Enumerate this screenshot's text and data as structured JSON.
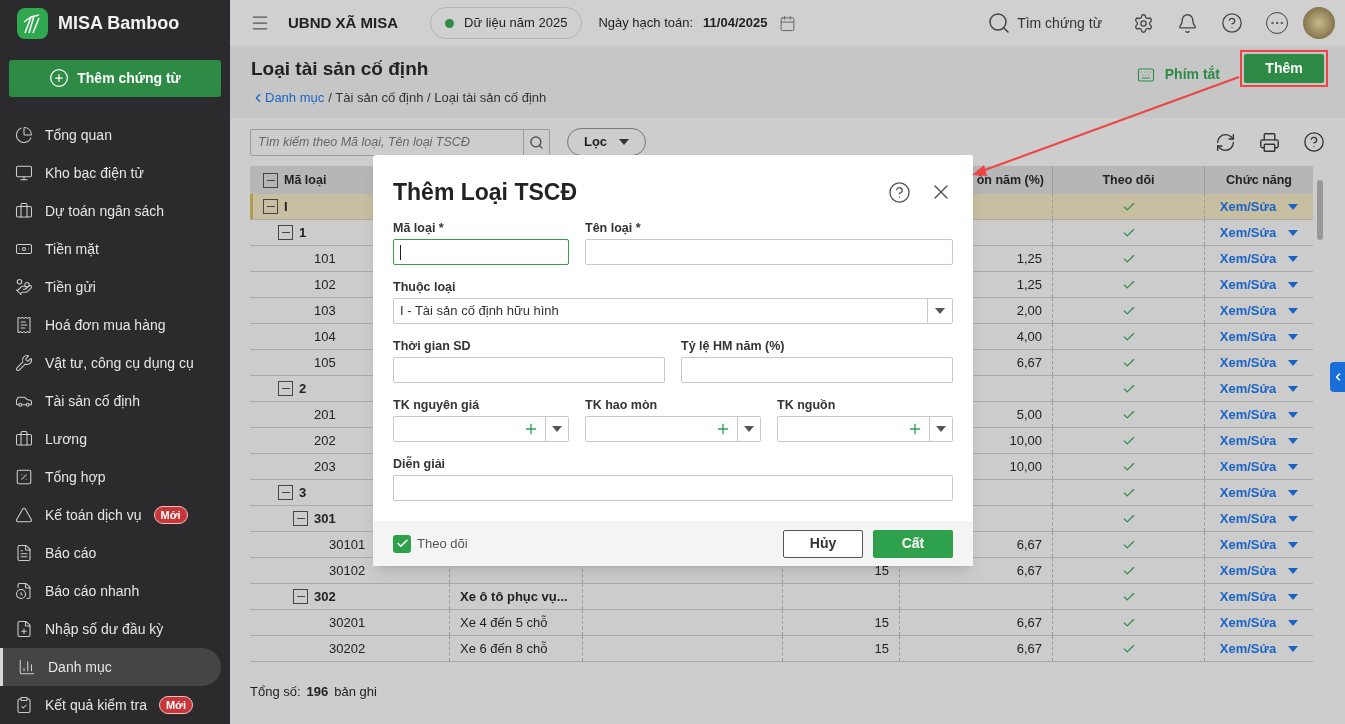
{
  "sidebar": {
    "brand": "MISA Bamboo",
    "new_button": "Thêm chứng từ",
    "items": [
      {
        "label": "Tổng quan",
        "selected": false
      },
      {
        "label": "Kho bạc điện tử",
        "selected": false
      },
      {
        "label": "Dự toán ngân sách",
        "selected": false
      },
      {
        "label": "Tiền mặt",
        "selected": false
      },
      {
        "label": "Tiền gửi",
        "selected": false
      },
      {
        "label": "Hoá đơn mua hàng",
        "selected": false
      },
      {
        "label": "Vật tư, công cụ dụng cụ",
        "selected": false
      },
      {
        "label": "Tài sản cố định",
        "selected": false
      },
      {
        "label": "Lương",
        "selected": false
      },
      {
        "label": "Tổng hợp",
        "selected": false
      },
      {
        "label": "Kế toán dịch vụ",
        "selected": false,
        "badge": "Mới"
      },
      {
        "label": "Báo cáo",
        "selected": false
      },
      {
        "label": "Báo cáo nhanh",
        "selected": false
      },
      {
        "label": "Nhập số dư đầu kỳ",
        "selected": false
      },
      {
        "label": "Danh mục",
        "selected": true
      },
      {
        "label": "Kết quả kiểm tra",
        "selected": false,
        "badge": "Mới"
      }
    ]
  },
  "topbar": {
    "organization": "UBND XÃ MISA",
    "data_year": "Dữ liệu năm 2025",
    "date_label": "Ngày hạch toán:",
    "date": "11/04/2025",
    "search": "Tìm chứng từ"
  },
  "page": {
    "title": "Loại tài sản cố định",
    "breadcrumb_link": "Danh mục",
    "breadcrumb_rest": "/ Tài sản cố định / Loại tài sản cố định",
    "shortcuts": "Phím tắt",
    "add_button": "Thêm"
  },
  "toolbar": {
    "search": {
      "placeholder": "Tìm kiếm theo Mã loại, Tên loại TSCĐ"
    },
    "filter": "Lọc"
  },
  "table": {
    "columns": {
      "code": "Mã loại",
      "column_5": "òn năm (%)",
      "tracked": "Theo dõi",
      "actions": "Chức năng"
    },
    "rows": [
      {
        "code": "I",
        "expanded": true,
        "selected": true,
        "tracked": true,
        "action": "Xem/Sửa",
        "children": [
          {
            "code": "1",
            "expanded": true,
            "selected": false,
            "tracked": true,
            "action": "Xem/Sửa",
            "children": [
              {
                "code": "101",
                "rate": "1,25",
                "selected": false,
                "tracked": true,
                "action": "Xem/Sửa"
              },
              {
                "code": "102",
                "rate": "1,25",
                "selected": false,
                "tracked": true,
                "action": "Xem/Sửa"
              },
              {
                "code": "103",
                "rate": "2,00",
                "selected": false,
                "tracked": true,
                "action": "Xem/Sửa"
              },
              {
                "code": "104",
                "rate": "4,00",
                "selected": false,
                "tracked": true,
                "action": "Xem/Sửa"
              },
              {
                "code": "105",
                "rate": "6,67",
                "selected": false,
                "tracked": true,
                "action": "Xem/Sửa"
              }
            ]
          },
          {
            "code": "2",
            "expanded": true,
            "selected": false,
            "tracked": true,
            "action": "Xem/Sửa",
            "children": [
              {
                "code": "201",
                "rate": "5,00",
                "selected": false,
                "tracked": true,
                "action": "Xem/Sửa"
              },
              {
                "code": "202",
                "rate": "10,00",
                "selected": false,
                "tracked": true,
                "action": "Xem/Sửa"
              },
              {
                "code": "203",
                "rate": "10,00",
                "selected": false,
                "tracked": true,
                "action": "Xem/Sửa"
              }
            ]
          },
          {
            "code": "3",
            "expanded": true,
            "selected": false,
            "tracked": true,
            "action": "Xem/Sửa",
            "children": [
              {
                "code": "301",
                "expanded": true,
                "selected": false,
                "tracked": true,
                "action": "Xem/Sửa",
                "children": [
                  {
                    "code": "30101",
                    "rate": "6,67",
                    "selected": false,
                    "tracked": true,
                    "action": "Xem/Sửa"
                  },
                  {
                    "code": "30102",
                    "column_4": "15",
                    "rate": "6,67",
                    "selected": false,
                    "tracked": true,
                    "action": "Xem/Sửa"
                  }
                ]
              },
              {
                "code": "302",
                "name": "Xe ô tô phục vụ...",
                "expanded": true,
                "selected": false,
                "tracked": true,
                "action": "Xem/Sửa",
                "children": [
                  {
                    "code": "30201",
                    "name": "Xe 4 đến 5 chỗ",
                    "column_4": "15",
                    "rate": "6,67",
                    "selected": false,
                    "tracked": true,
                    "action": "Xem/Sửa"
                  },
                  {
                    "code": "30202",
                    "name": "Xe 6 đến 8 chỗ",
                    "column_4": "15",
                    "rate": "6,67",
                    "selected": false,
                    "tracked": true,
                    "action": "Xem/Sửa"
                  }
                ]
              }
            ]
          }
        ]
      }
    ],
    "total_label": "Tổng số:",
    "total": "196",
    "total_suffix": "bản ghi"
  },
  "dialog": {
    "title": "Thêm Loại TSCĐ",
    "rows": [
      {
        "fields": [
          {
            "label": "Mã loại *",
            "kind": "text",
            "focused": true
          },
          {
            "label": "Tên loại *",
            "kind": "text",
            "focused": false
          }
        ]
      },
      {
        "fields": [
          {
            "label": "Thuộc loại",
            "kind": "select",
            "value": "I - Tài sản cố định hữu hình",
            "focused": false
          }
        ]
      },
      {
        "fields": [
          {
            "label": "Thời gian SD",
            "kind": "text",
            "focused": false
          },
          {
            "label": "Tỷ lệ HM năm (%)",
            "kind": "text",
            "focused": false
          }
        ]
      },
      {
        "fields": [
          {
            "label": "TK nguyên giá",
            "kind": "account",
            "focused": false
          },
          {
            "label": "TK hao mòn",
            "kind": "account",
            "focused": false
          },
          {
            "label": "TK nguồn",
            "kind": "account",
            "focused": false
          }
        ]
      },
      {
        "fields": [
          {
            "label": "Diễn giải",
            "kind": "text",
            "focused": false
          }
        ]
      }
    ],
    "tracked": {
      "label": "Theo dõi",
      "checked": true
    },
    "cancel": "Hủy",
    "save": "Cất"
  }
}
